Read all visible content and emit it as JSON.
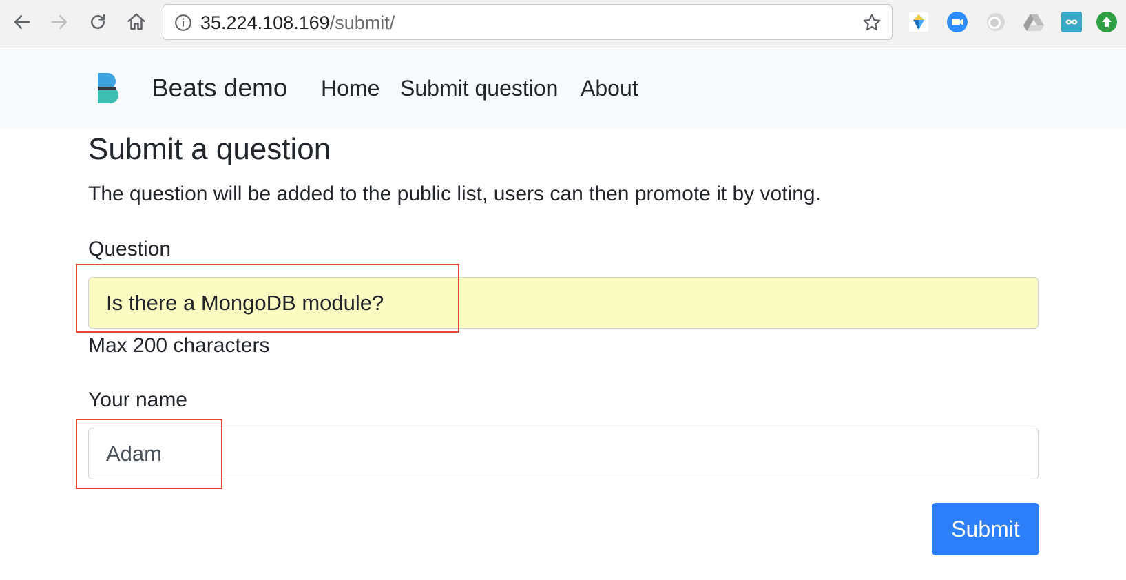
{
  "browser": {
    "url_host": "35.224.108.169",
    "url_path": "/submit/"
  },
  "navbar": {
    "brand": "Beats demo",
    "links": [
      "Home",
      "Submit question",
      "About"
    ]
  },
  "main": {
    "title": "Submit a question",
    "lead": "The question will be added to the public list, users can then promote it by voting.",
    "question_label": "Question",
    "question_value": "Is there a MongoDB module?",
    "question_help": "Max 200 characters",
    "name_label": "Your name",
    "name_value": "Adam",
    "submit_label": "Submit"
  },
  "colors": {
    "accent": "#2d7ff9",
    "autofill_bg": "#fafcc2",
    "annotation": "#e04a3a",
    "navbar_bg": "#f8f9fa"
  }
}
